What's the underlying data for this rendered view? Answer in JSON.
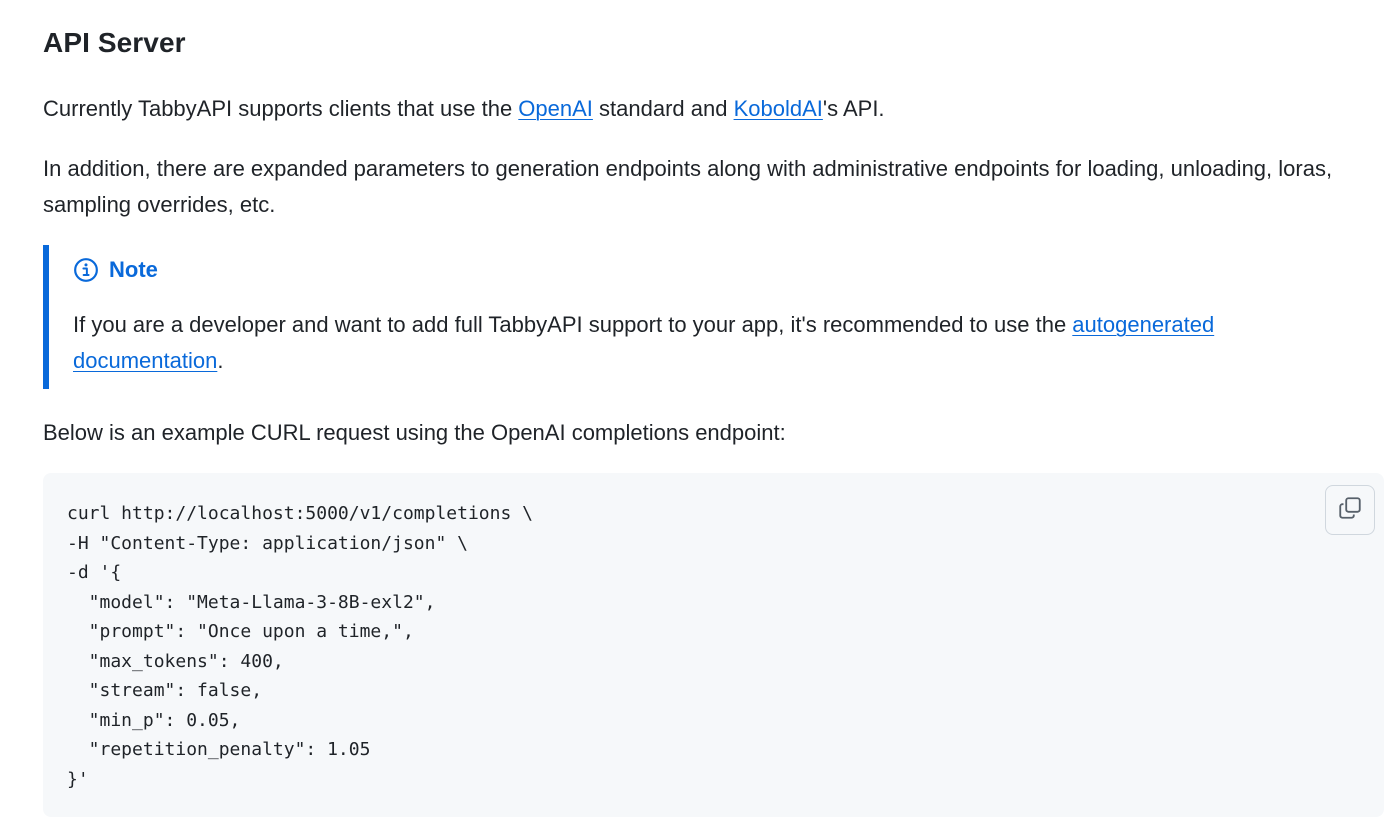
{
  "heading": "API Server",
  "intro": {
    "prefix": "Currently TabbyAPI supports clients that use the ",
    "link1": "OpenAI",
    "middle": " standard and ",
    "link2": "KoboldAI",
    "suffix": "'s API."
  },
  "addition_text": "In addition, there are expanded parameters to generation endpoints along with administrative endpoints for loading, unloading, loras, sampling overrides, etc.",
  "note": {
    "icon": "info-icon",
    "title": "Note",
    "body_prefix": "If you are a developer and want to add full TabbyAPI support to your app, it's recommended to use the ",
    "link": "autogenerated documentation",
    "body_suffix": "."
  },
  "example_intro": "Below is an example CURL request using the OpenAI completions endpoint:",
  "code": {
    "lines": [
      "curl http://localhost:5000/v1/completions \\",
      "-H \"Content-Type: application/json\" \\",
      "-d '{",
      "  \"model\": \"Meta-Llama-3-8B-exl2\",",
      "  \"prompt\": \"Once upon a time,\",",
      "  \"max_tokens\": 400,",
      "  \"stream\": false,",
      "  \"min_p\": 0.05,",
      "  \"repetition_penalty\": 1.05",
      "}'"
    ],
    "copy_icon": "copy-icon"
  },
  "colors": {
    "accent": "#0969da",
    "text": "#1f2328",
    "code_bg": "#f6f8fa"
  }
}
